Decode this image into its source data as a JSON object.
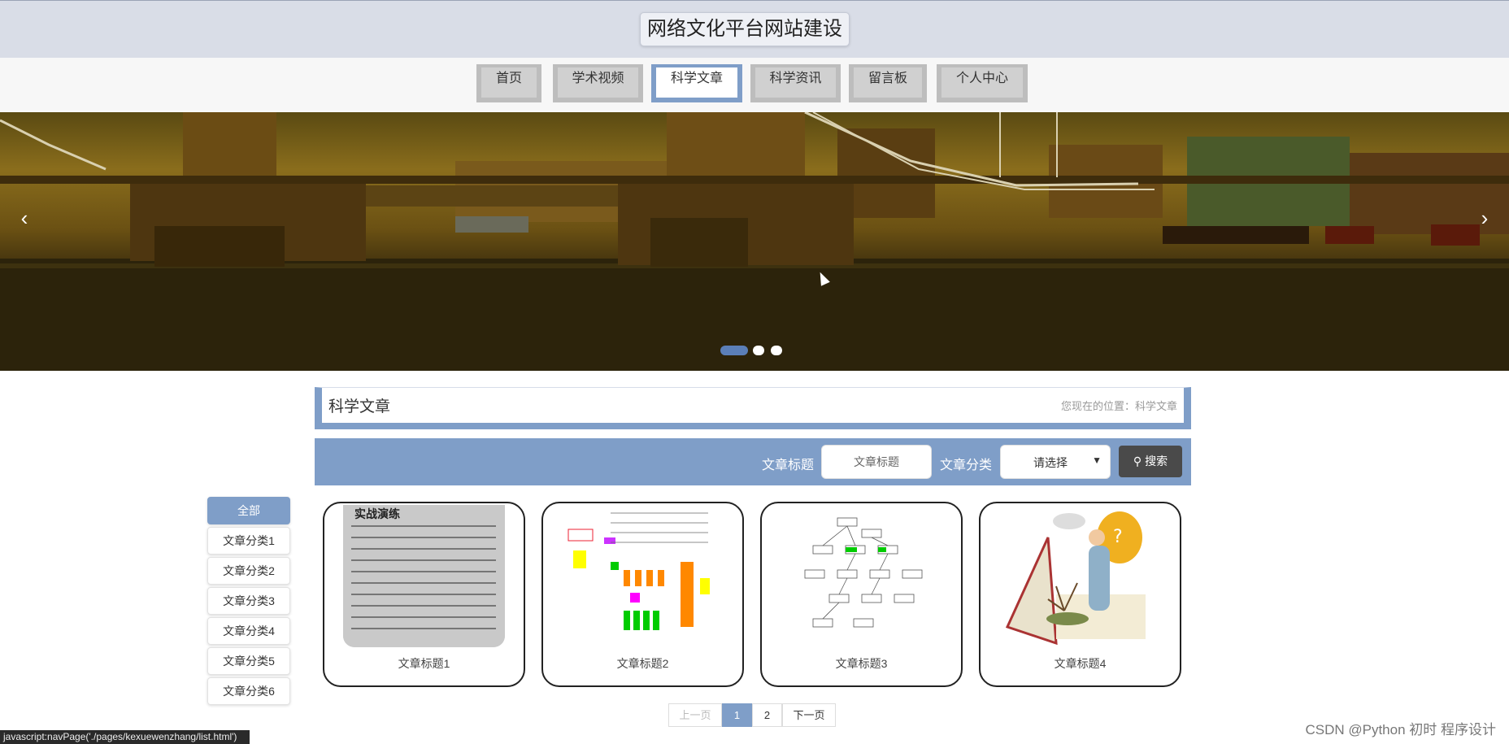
{
  "header": {
    "site_title": "网络文化平台网站建设"
  },
  "nav": {
    "items": [
      {
        "label": "首页",
        "active": false
      },
      {
        "label": "学术视频",
        "active": false
      },
      {
        "label": "科学文章",
        "active": true
      },
      {
        "label": "科学资讯",
        "active": false
      },
      {
        "label": "留言板",
        "active": false
      },
      {
        "label": "个人中心",
        "active": false
      }
    ]
  },
  "banner": {
    "prev": "‹",
    "next": "›",
    "slide_count": 3,
    "active_slide": 1
  },
  "section": {
    "title": "科学文章",
    "breadcrumb": "您现在的位置：科学文章"
  },
  "search": {
    "title_label": "文章标题",
    "title_placeholder": "文章标题",
    "category_label": "文章分类",
    "category_value": "请选择",
    "button_label": "搜索"
  },
  "categories": [
    {
      "label": "全部",
      "active": true
    },
    {
      "label": "文章分类1"
    },
    {
      "label": "文章分类2"
    },
    {
      "label": "文章分类3"
    },
    {
      "label": "文章分类4"
    },
    {
      "label": "文章分类5"
    },
    {
      "label": "文章分类6"
    }
  ],
  "articles": [
    {
      "title": "文章标题1",
      "thumb": "book-page",
      "thumb_text": "实战演练"
    },
    {
      "title": "文章标题2",
      "thumb": "flowchart-color"
    },
    {
      "title": "文章标题3",
      "thumb": "flowchart-mono"
    },
    {
      "title": "文章标题4",
      "thumb": "illustration"
    }
  ],
  "pagination": {
    "prev": "上一页",
    "pages": [
      "1",
      "2"
    ],
    "current": "1",
    "next": "下一页"
  },
  "statusbar": {
    "text": "javascript:navPage('./pages/kexuewenzhang/list.html')"
  },
  "watermark": {
    "text": "CSDN @Python 初时 程序设计"
  },
  "colors": {
    "accent": "#7f9ec8",
    "header_bg": "#d9dde7",
    "button_dark": "#4a4a4a"
  }
}
